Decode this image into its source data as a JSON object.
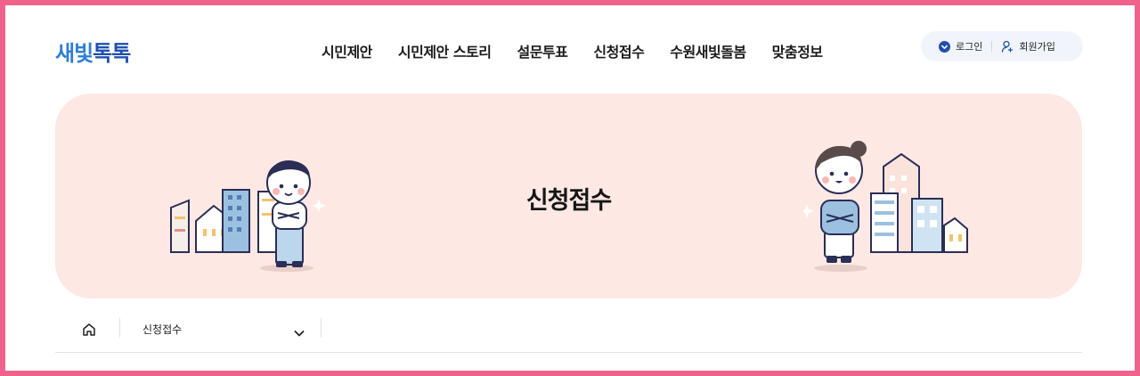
{
  "logo": {
    "part1": "새빛",
    "part2": "톡톡"
  },
  "nav": {
    "items": [
      {
        "label": "시민제안"
      },
      {
        "label": "시민제안 스토리"
      },
      {
        "label": "설문투표"
      },
      {
        "label": "신청접수"
      },
      {
        "label": "수원새빛돌봄"
      },
      {
        "label": "맞춤정보"
      }
    ]
  },
  "util": {
    "login_label": "로그인",
    "signup_label": "회원가입"
  },
  "banner": {
    "title": "신청접수"
  },
  "breadcrumb": {
    "current": "신청접수"
  },
  "icons": {
    "login": "login-icon",
    "signup": "user-plus-icon",
    "home": "home-icon",
    "dropdown": "chevron-down-icon"
  },
  "colors": {
    "frame_border": "#f0628c",
    "logo_light": "#2e7fd8",
    "logo_dark": "#1f4fb0",
    "banner_bg": "#fde8e4",
    "util_bg": "#f1f5fb"
  }
}
